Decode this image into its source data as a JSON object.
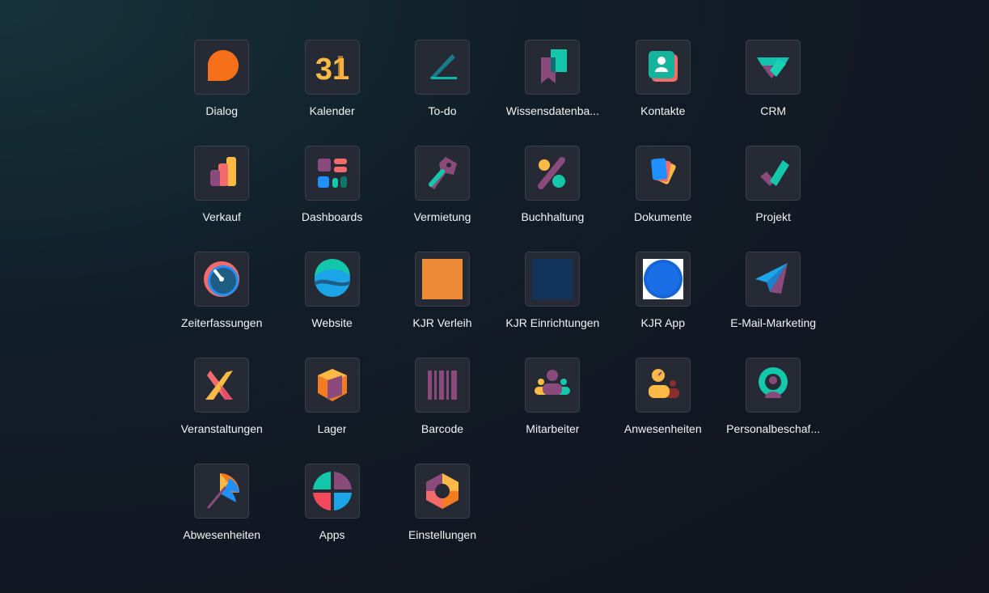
{
  "apps": [
    {
      "label": "Dialog",
      "icon": "dialog-icon"
    },
    {
      "label": "Kalender",
      "icon": "calendar-icon",
      "icon_text": "31"
    },
    {
      "label": "To-do",
      "icon": "todo-icon"
    },
    {
      "label": "Wissensdatenba...",
      "icon": "knowledge-icon"
    },
    {
      "label": "Kontakte",
      "icon": "contacts-icon"
    },
    {
      "label": "CRM",
      "icon": "crm-icon"
    },
    {
      "label": "Verkauf",
      "icon": "sales-icon"
    },
    {
      "label": "Dashboards",
      "icon": "dashboards-icon"
    },
    {
      "label": "Vermietung",
      "icon": "rental-icon"
    },
    {
      "label": "Buchhaltung",
      "icon": "accounting-icon"
    },
    {
      "label": "Dokumente",
      "icon": "documents-icon"
    },
    {
      "label": "Projekt",
      "icon": "project-icon"
    },
    {
      "label": "Zeiterfassungen",
      "icon": "timesheet-icon"
    },
    {
      "label": "Website",
      "icon": "website-icon"
    },
    {
      "label": "KJR Verleih",
      "icon": "orange-square-icon"
    },
    {
      "label": "KJR Einrichtungen",
      "icon": "navy-square-icon"
    },
    {
      "label": "KJR App",
      "icon": "blue-circle-icon"
    },
    {
      "label": "E-Mail-Marketing",
      "icon": "paper-plane-icon"
    },
    {
      "label": "Veranstaltungen",
      "icon": "events-icon"
    },
    {
      "label": "Lager",
      "icon": "inventory-icon"
    },
    {
      "label": "Barcode",
      "icon": "barcode-icon"
    },
    {
      "label": "Mitarbeiter",
      "icon": "employees-icon"
    },
    {
      "label": "Anwesenheiten",
      "icon": "attendance-icon"
    },
    {
      "label": "Personalbeschaf...",
      "icon": "recruitment-icon"
    },
    {
      "label": "Abwesenheiten",
      "icon": "time-off-icon"
    },
    {
      "label": "Apps",
      "icon": "apps-icon"
    },
    {
      "label": "Einstellungen",
      "icon": "settings-icon"
    }
  ]
}
